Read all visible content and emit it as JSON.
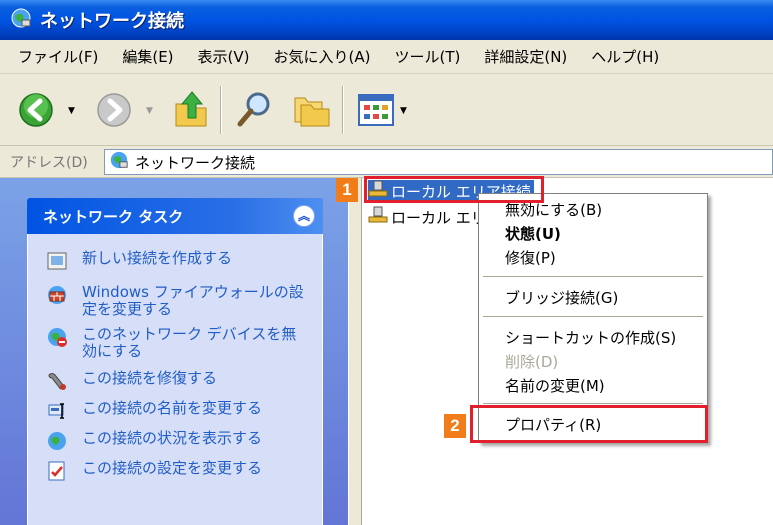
{
  "window": {
    "title": "ネットワーク接続"
  },
  "menubar": {
    "items": [
      "ファイル(F)",
      "編集(E)",
      "表示(V)",
      "お気に入り(A)",
      "ツール(T)",
      "詳細設定(N)",
      "ヘルプ(H)"
    ]
  },
  "toolbar": {
    "icons": [
      "back-icon",
      "forward-icon",
      "up-folder-icon",
      "search-icon",
      "folders-icon",
      "views-icon"
    ]
  },
  "address": {
    "label": "アドレス(D)",
    "value": "ネットワーク接続"
  },
  "tasks": {
    "header": "ネットワーク タスク",
    "items": [
      "新しい接続を作成する",
      "Windows ファイアウォールの設定を変更する",
      "このネットワーク デバイスを無効にする",
      "この接続を修復する",
      "この接続の名前を変更する",
      "この接続の状況を表示する",
      "この接続の設定を変更する"
    ]
  },
  "connections": {
    "items": [
      "ローカル エリア接続",
      "ローカル エリ"
    ]
  },
  "context_menu": {
    "items": [
      "無効にする(B)",
      "状態(U)",
      "修復(P)",
      "ブリッジ接続(G)",
      "ショートカットの作成(S)",
      "削除(D)",
      "名前の変更(M)",
      "プロパティ(R)"
    ]
  },
  "annotations": {
    "step1": "1",
    "step2": "2",
    "highlight_color": "#e2202d",
    "badge_color": "#f07d1a"
  }
}
